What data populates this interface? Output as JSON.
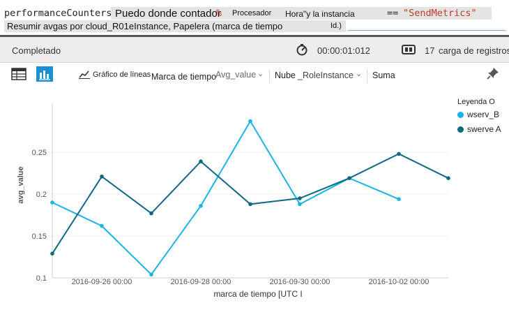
{
  "query": {
    "line1_code": "performanceCounters",
    "line1_text_a": "Puedo donde contador",
    "line1_op": "%",
    "line1_text_b": "Procesador",
    "line1_text_c": "Hora\"y la instancia",
    "line1_eq": "==",
    "line1_string": "\"SendMetrics\"",
    "line2_text": "Resumir avgas por cloud_R01eInstance, Papelera (marca de tiempo",
    "line2_tail": "Id.)"
  },
  "status": {
    "state": "Completado",
    "duration": "00:00:01:012",
    "record_count": "17",
    "record_label": "carga de registros"
  },
  "toolbar": {
    "chart_type_label": "Gráfico de líneas",
    "x_field": "Marca de tiempo",
    "y_field": "Avg_value",
    "split_label": "Nube",
    "split_field": "_RoleInstance",
    "aggregation": "Suma"
  },
  "colors": {
    "series_b": "#1ab3e8",
    "series_a": "#0e6882",
    "axis": "#cccccc",
    "grid": "#eeeeee"
  },
  "chart_data": {
    "type": "line",
    "xlabel": "marca de tiempo [UTC I",
    "ylabel": "avg_value",
    "legend_title": "Leyenda O",
    "legend_position": "right",
    "x_ticks": [
      "2016-09-26 00:00",
      "2016-09-28 00:00",
      "2016-09-30 00:00",
      "2016-10-02 00:00"
    ],
    "y_ticks": [
      "0.1",
      "0.15",
      "0.2",
      "0.25"
    ],
    "ylim": [
      0.1,
      0.3
    ],
    "x": [
      "2016-09-25",
      "2016-09-26",
      "2016-09-27",
      "2016-09-28",
      "2016-09-29",
      "2016-09-30",
      "2016-10-01",
      "2016-10-02",
      "2016-10-03"
    ],
    "series": [
      {
        "name": "wserv_B",
        "values": [
          0.19,
          0.162,
          0.104,
          0.186,
          0.287,
          0.188,
          0.219,
          0.194,
          null
        ]
      },
      {
        "name": "swerve A",
        "values": [
          0.129,
          0.221,
          0.177,
          0.239,
          0.188,
          0.195,
          0.219,
          0.248,
          0.219
        ]
      }
    ]
  }
}
